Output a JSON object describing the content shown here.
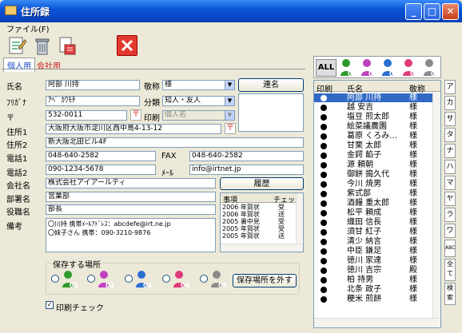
{
  "window": {
    "title": "住所録",
    "min": "_",
    "max": "□",
    "close": "✕"
  },
  "menu": {
    "file": "ファイル(F)"
  },
  "tabs": {
    "personal": "個人用",
    "company": "会社用"
  },
  "form": {
    "name_label": "氏名",
    "name": "阿部 川持",
    "honorific_label": "敬称",
    "honorific": "様",
    "joint_button": "連名",
    "kana_label": "ﾌﾘｶﾞﾅ",
    "kana": "ｱﾍﾞ ｶﾜﾓﾁ",
    "category_label": "分類",
    "category": "知人・友人",
    "zip_label": "〒",
    "zip": "532-0011",
    "zip_btn": "〒",
    "print_label": "印刷",
    "print": "個人名",
    "addr1_label": "住所1",
    "addr1": "大阪府大阪市淀川区西中島4-13-12",
    "addr_btn": "〒",
    "addr2_label": "住所2",
    "addr2": "新大阪北田ビル4F",
    "tel1_label": "電話1",
    "tel1": "048-640-2582",
    "fax_label": "FAX",
    "fax": "048-640-2582",
    "tel2_label": "電話2",
    "tel2": "090-1234-5678",
    "mail_label": "ﾒｰﾙ",
    "mail": "info@irtnet.jp",
    "company_label": "会社名",
    "company": "株式会社アイアールティ",
    "history_button": "履歴",
    "dept_label": "部署名",
    "dept": "営業部",
    "title_label": "役職名",
    "title": "部長",
    "note_label": "備考",
    "note_line1": "〇川持 携帯ﾒｰﾙｱﾄﾞﾚｽ：abcdefe@irt.ne.jp",
    "note_line2": "〇妹子さん 携帯：090-3210-9876",
    "print_check_label": "印刷チェック"
  },
  "history": {
    "headers": [
      "事項",
      "チェック"
    ],
    "rows": [
      [
        "2006 年賀状",
        "受"
      ],
      [
        "2006 年賀状",
        "送"
      ],
      [
        "2005 暑中見",
        "受"
      ],
      [
        "2005 年賀状",
        "受"
      ],
      [
        "2005 年賀状",
        "送"
      ]
    ]
  },
  "locations": {
    "label": "保存する場所",
    "items": [
      {
        "num": "01",
        "color": "#2e9b2e"
      },
      {
        "num": "02",
        "color": "#c040c0"
      },
      {
        "num": "03",
        "color": "#2a6fd0"
      },
      {
        "num": "04",
        "color": "#e03a7a"
      },
      {
        "num": "05",
        "color": "#8a8a8a"
      }
    ],
    "remove_button": "保存場所を外す"
  },
  "group_bar": {
    "all": "ALL",
    "groups": [
      "01",
      "02",
      "03",
      "04",
      "05"
    ]
  },
  "list": {
    "headers": [
      "印刷",
      "氏名",
      "敬称"
    ],
    "rows": [
      [
        "阿部 川持",
        "様"
      ],
      [
        "越 安吉",
        "様"
      ],
      [
        "塩豆 煎太郎",
        "様"
      ],
      [
        "絵菜議農園",
        "様"
      ],
      [
        "葛原 くろみ…",
        "様"
      ],
      [
        "甘栗 太郎",
        "様"
      ],
      [
        "金鍔 餡子",
        "様"
      ],
      [
        "源 頼朝",
        "様"
      ],
      [
        "御餅 搗久代",
        "様"
      ],
      [
        "今川 焼男",
        "様"
      ],
      [
        "紫式部",
        "様"
      ],
      [
        "酒饅 重太郎",
        "様"
      ],
      [
        "松平 頼成",
        "様"
      ],
      [
        "織田 信長",
        "様"
      ],
      [
        "須甘 紅子",
        "様"
      ],
      [
        "清少 納言",
        "様"
      ],
      [
        "中臣 鎌足",
        "様"
      ],
      [
        "徳川 家達",
        "様"
      ],
      [
        "徳川 吉宗",
        "殿"
      ],
      [
        "柏 持男",
        "様"
      ],
      [
        "北条 政子",
        "様"
      ],
      [
        "粳米 煎餅",
        "様"
      ]
    ]
  },
  "letters": [
    "ア",
    "カ",
    "サ",
    "タ",
    "ナ",
    "ハ",
    "マ",
    "ヤ",
    "ラ",
    "ワ",
    "ABC",
    "全て",
    "検索"
  ]
}
